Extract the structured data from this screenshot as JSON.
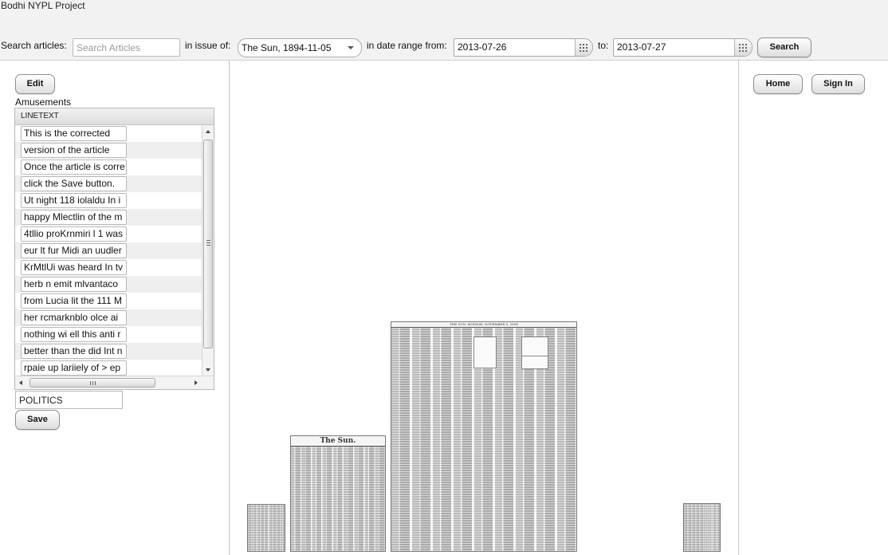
{
  "app": {
    "title": "Bodhi NYPL Project"
  },
  "search": {
    "articles_label": "Search articles:",
    "articles_placeholder": "Search Articles",
    "articles_value": "",
    "issue_label": "in issue of:",
    "issue_value": "The Sun, 1894-11-05",
    "range_from_label": "in date range from:",
    "range_from_value": "2013-07-26",
    "range_to_label": "to:",
    "range_to_value": "2013-07-27",
    "search_button": "Search"
  },
  "editor": {
    "edit_button": "Edit",
    "section_title": "Amusements",
    "column_header": "LINETEXT",
    "rows": [
      "This is the corrected",
      "version of the article",
      "Once the article is corre",
      "click the Save button.",
      "Ut night 118 iolaldu In i",
      "happy Mlectlin of the m",
      "4tllio proKrnmiri l 1 was",
      "eur lt fur Midi an uudler",
      "KrMtlUi was heard In tv",
      "herb n emit mlvantaco",
      "from Lucia lit the 111 M",
      " her rcmarknblo olce ai",
      "nothing wi ell this anti r",
      "better than the did Int n",
      "rpaie up lariiely of > ep"
    ],
    "category_value": "POLITICS",
    "save_button": "Save"
  },
  "viewer": {
    "pages": [
      {
        "name": "page-thumb-left-small",
        "masthead": ""
      },
      {
        "name": "page-front",
        "masthead": "The Sun."
      },
      {
        "name": "page-current",
        "masthead": "THE SUN, MONDAY, NOVEMBER 5, 1894"
      },
      {
        "name": "page-thumb-right-small",
        "masthead": ""
      }
    ]
  },
  "nav": {
    "home_button": "Home",
    "sign_in_button": "Sign In"
  }
}
